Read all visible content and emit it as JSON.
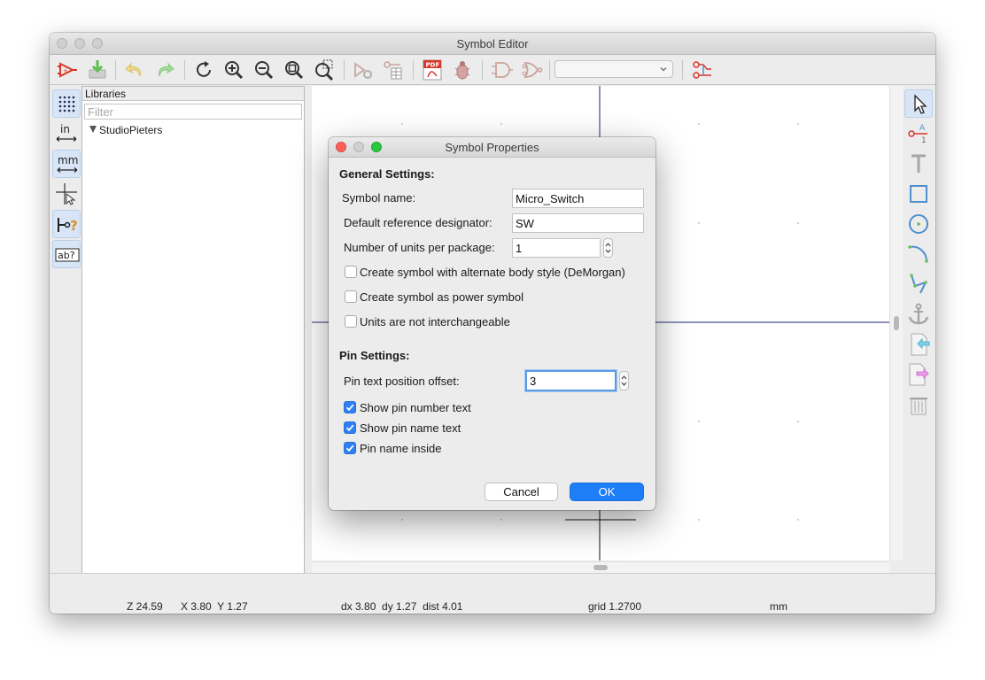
{
  "window": {
    "title": "Symbol Editor"
  },
  "toolbar": {
    "buttons": [
      "new-symbol-icon",
      "save-icon",
      "undo-icon",
      "redo-icon",
      "rotate-icon",
      "zoom-in-icon",
      "zoom-out-icon",
      "zoom-fit-icon",
      "zoom-selection-icon",
      "symbol-properties-icon",
      "pin-table-icon",
      "export-pdf-icon",
      "bug-icon",
      "deMorgan-normal-icon",
      "deMorgan-alt-icon",
      "unit-select",
      "show-pins-icon"
    ],
    "pdf_label": "PDF",
    "unit_select_value": ""
  },
  "left_tools": {
    "grid": "grid-icon",
    "inches_label": "in",
    "mm_label": "mm",
    "cursor": "full-crosshair-icon",
    "pin_type": "pin-type-icon",
    "text_label": "ab?"
  },
  "libraries": {
    "header": "Libraries",
    "filter_placeholder": "Filter",
    "filter_value": "",
    "items": [
      {
        "label": "StudioPieters",
        "expanded": true
      }
    ]
  },
  "right_tools": [
    "select-arrow-icon",
    "pin-tool-icon",
    "text-tool-icon",
    "rectangle-tool-icon",
    "circle-tool-icon",
    "arc-tool-icon",
    "polyline-tool-icon",
    "anchor-icon",
    "import-graphics-icon",
    "export-graphics-icon",
    "delete-tool-icon"
  ],
  "status": {
    "zoom": "Z 24.59",
    "xy": "X 3.80  Y 1.27",
    "delta": "dx 3.80  dy 1.27  dist 4.01",
    "grid": "grid 1.2700",
    "units": "mm"
  },
  "dialog": {
    "title": "Symbol Properties",
    "general_section": "General Settings:",
    "symbol_name_label": "Symbol name:",
    "symbol_name_value": "Micro_Switch",
    "ref_label": "Default reference designator:",
    "ref_value": "SW",
    "units_label": "Number of units per package:",
    "units_value": "1",
    "alt_body_label": "Create symbol with alternate body style (DeMorgan)",
    "alt_body_checked": false,
    "power_label": "Create symbol as power symbol",
    "power_checked": false,
    "interchangeable_label": "Units are not interchangeable",
    "interchangeable_checked": false,
    "pin_section": "Pin Settings:",
    "pin_offset_label": "Pin text position offset:",
    "pin_offset_value": "3",
    "show_pin_number_label": "Show pin number text",
    "show_pin_number_checked": true,
    "show_pin_name_label": "Show pin name text",
    "show_pin_name_checked": true,
    "pin_name_inside_label": "Pin name inside",
    "pin_name_inside_checked": true,
    "cancel_label": "Cancel",
    "ok_label": "OK"
  },
  "colors": {
    "accent": "#1d7ef7",
    "toolbar_red": "#d9362b",
    "axis": "#1f2670",
    "tool_blue": "#4f8fd0",
    "tool_gray": "#a6a6a6"
  }
}
